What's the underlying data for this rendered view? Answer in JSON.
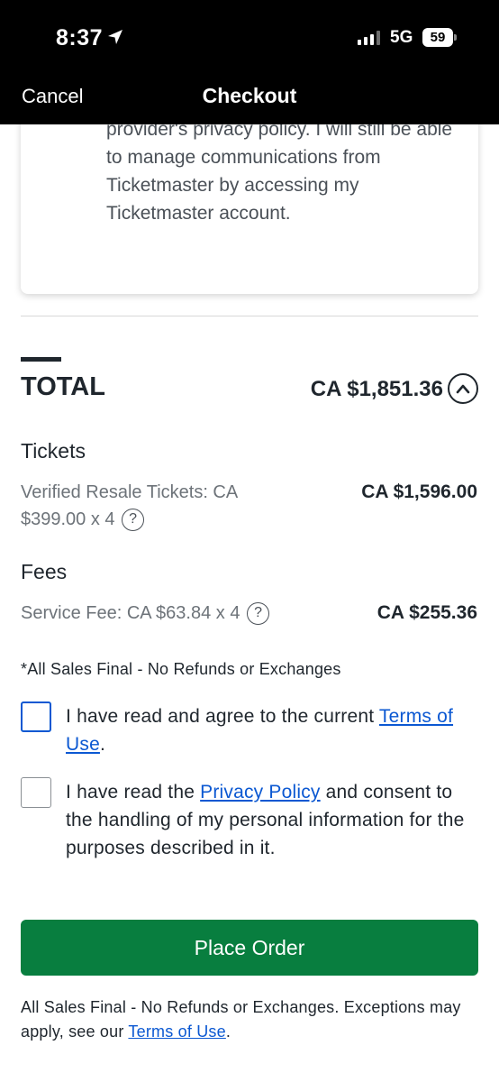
{
  "status_bar": {
    "time": "8:37",
    "network": "5G",
    "battery": "59"
  },
  "nav": {
    "cancel_label": "Cancel",
    "title": "Checkout"
  },
  "consent_card": {
    "text": "provider's privacy policy. I will still be able to manage communications from Ticketmaster by accessing my Ticketmaster account."
  },
  "summary": {
    "total_label": "TOTAL",
    "total_amount": "CA $1,851.36",
    "tickets": {
      "title": "Tickets",
      "description": "Verified Resale Tickets: CA $399.00 x 4",
      "amount": "CA $1,596.00"
    },
    "fees": {
      "title": "Fees",
      "description": "Service Fee: CA $63.84 x 4",
      "amount": "CA $255.36"
    },
    "help_glyph": "?"
  },
  "sales_final_note": "*All Sales Final - No Refunds or Exchanges",
  "terms_consent": {
    "text_before": "I have read and agree to the current ",
    "link": "Terms of Use",
    "text_after": "."
  },
  "privacy_consent": {
    "text_before": "I have read the ",
    "link": "Privacy Policy",
    "text_after": " and consent to the handling of my personal information for the purposes described in it."
  },
  "place_order_label": "Place Order",
  "footer": {
    "text": "All Sales Final - No Refunds or Exchanges. Exceptions may apply, see our ",
    "link": "Terms of Use",
    "text_after": "."
  },
  "colors": {
    "primary_green": "#087e3f",
    "link_blue": "#0b58d2",
    "topbar": "#000000"
  },
  "icons": [
    "location-arrow-icon",
    "signal-icon",
    "battery-icon",
    "chevron-up-icon",
    "help-icon"
  ]
}
